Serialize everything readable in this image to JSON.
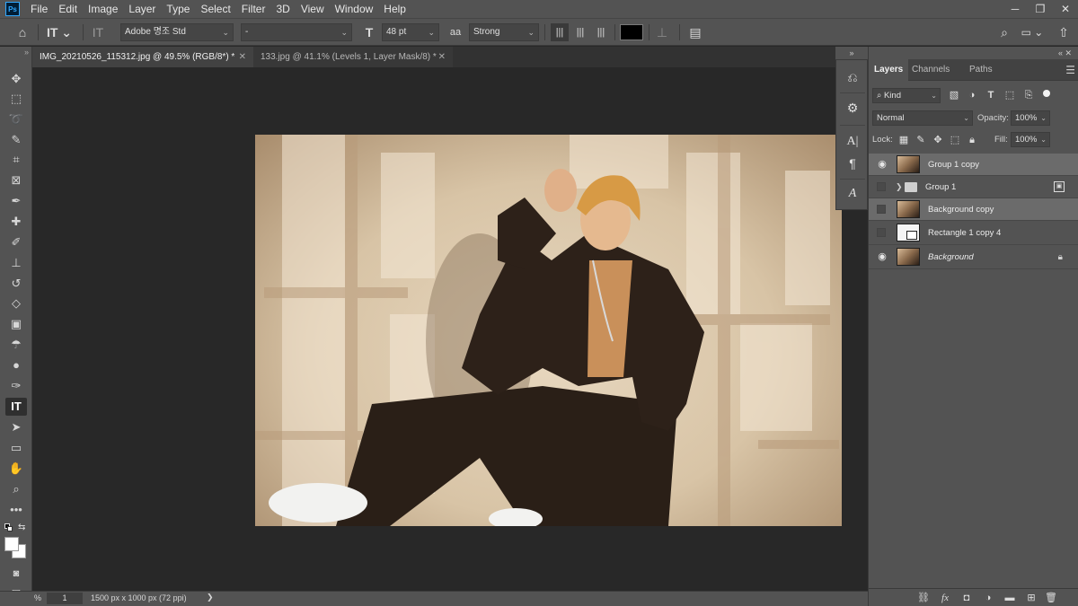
{
  "menu": {
    "app_icon": "Ps",
    "items": [
      "File",
      "Edit",
      "Image",
      "Layer",
      "Type",
      "Select",
      "Filter",
      "3D",
      "View",
      "Window",
      "Help"
    ],
    "window_controls": [
      "minimize-icon",
      "restore-icon",
      "close-icon"
    ]
  },
  "options": {
    "home_icon": "home-icon",
    "tool_icon": "type-tool-icon",
    "orient_icon": "text-orientation-icon",
    "font_family": "Adobe 명조 Std",
    "font_style": "-",
    "size_icon": "font-size-icon",
    "font_size": "48 pt",
    "aa_icon": "anti-alias-icon",
    "aa_label": "aa",
    "antialias": "Strong",
    "align_icons": [
      "align-left-icon",
      "align-center-icon",
      "align-right-icon"
    ],
    "text_color": "#000000",
    "warp_icon": "warp-text-icon",
    "panels_icon": "character-panel-icon",
    "search_icon": "search-icon",
    "workspace_icon": "workspace-icon",
    "share_icon": "share-icon"
  },
  "tabs": [
    {
      "label": "IMG_20210526_115312.jpg @ 49.5% (RGB/8*) *",
      "active": true
    },
    {
      "label": "133.jpg @ 41.1% (Levels 1, Layer Mask/8) *",
      "active": false
    }
  ],
  "tools": [
    "move-icon",
    "marquee-icon",
    "lasso-icon",
    "quick-select-icon",
    "crop-icon",
    "frame-icon",
    "eyedropper-icon",
    "healing-icon",
    "brush-icon",
    "stamp-icon",
    "history-brush-icon",
    "eraser-icon",
    "gradient-icon",
    "blur-icon",
    "dodge-icon",
    "pen-icon",
    "type-icon",
    "path-select-icon",
    "rectangle-icon",
    "hand-icon",
    "zoom-icon",
    "more-tools-icon"
  ],
  "status": {
    "zoom_suffix": "%",
    "zoom_value": "1",
    "doc_info": "1500 px x 1000 px (72 ppi)",
    "arrow": "❯"
  },
  "dock": {
    "items": [
      "history-icon",
      "properties-icon",
      "character-icon",
      "paragraph-icon",
      "glyphs-icon"
    ]
  },
  "layers_panel": {
    "tabs": [
      "Layers",
      "Channels",
      "Paths"
    ],
    "active_tab": "Layers",
    "filter_kind": "Kind",
    "blend_mode": "Normal",
    "opacity_label": "Opacity:",
    "opacity_value": "100%",
    "lock_label": "Lock:",
    "fill_label": "Fill:",
    "fill_value": "100%",
    "layers": [
      {
        "name": "Group 1 copy",
        "visible": true,
        "selected": true,
        "type": "image"
      },
      {
        "name": "Group 1",
        "visible": false,
        "selected": false,
        "type": "group"
      },
      {
        "name": "Background copy",
        "visible": false,
        "selected": true,
        "type": "image"
      },
      {
        "name": "Rectangle 1 copy 4",
        "visible": false,
        "selected": false,
        "type": "shape"
      },
      {
        "name": "Background",
        "visible": true,
        "selected": false,
        "type": "background",
        "locked": true
      }
    ],
    "footer_icons": [
      "link-icon",
      "fx-icon",
      "mask-icon",
      "adjustment-icon",
      "new-group-icon",
      "new-layer-icon",
      "trash-icon"
    ]
  }
}
